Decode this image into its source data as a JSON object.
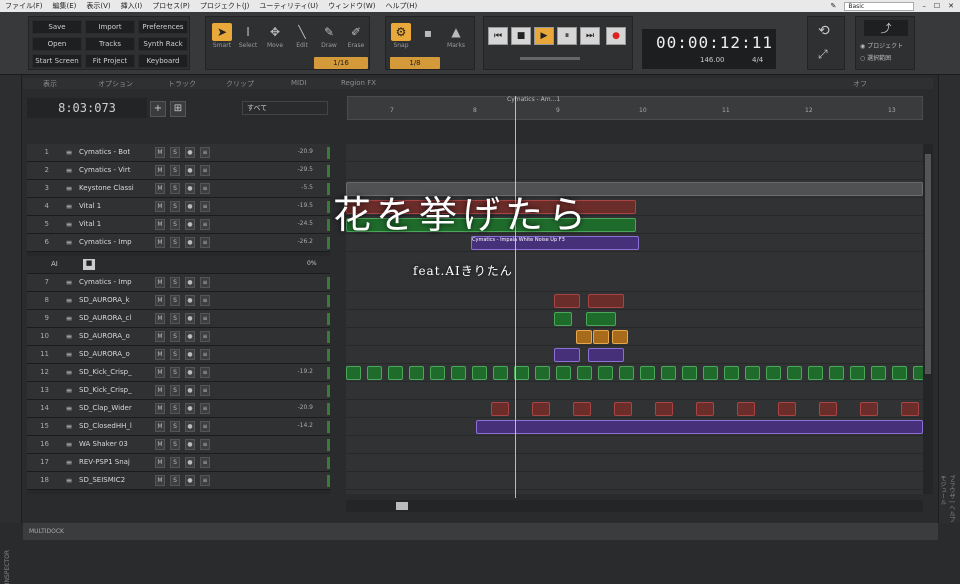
{
  "menu": {
    "items": [
      "ファイル(F)",
      "編集(E)",
      "表示(V)",
      "挿入(I)",
      "プロセス(P)",
      "プロジェクト(J)",
      "ユーティリティ(U)",
      "ウィンドウ(W)",
      "ヘルプ(H)"
    ],
    "workspace": "Basic"
  },
  "control": {
    "buttons": [
      "Save",
      "Import",
      "Preferences",
      "Open",
      "Tracks",
      "Synth Rack",
      "Start Screen",
      "Fit Project",
      "Keyboard"
    ],
    "tools": [
      "Smart",
      "Select",
      "Move",
      "Edit",
      "Draw",
      "Erase"
    ],
    "snap_label": "Snap",
    "snap_value": "1/16",
    "marks_label": "Marks",
    "marks_value": "1/8",
    "time": "00:00:12:11",
    "tempo": "146.00",
    "meter": "4/4",
    "option1": "プロジェクト",
    "option2": "選択範囲"
  },
  "tabs": [
    "表示",
    "オプション",
    "トラック",
    "クリップ",
    "MIDI",
    "Region FX",
    "オフ"
  ],
  "clock": "8:03:073",
  "filter": "すべて",
  "region_name": "Cymatics - Am...1",
  "ruler_ticks": [
    "7",
    "8",
    "9",
    "10",
    "11",
    "12",
    "13"
  ],
  "tracks": [
    {
      "num": "1",
      "name": "Cymatics - Bot",
      "vol": "-20.9"
    },
    {
      "num": "2",
      "name": "Cymatics - Virt",
      "vol": "-29.5"
    },
    {
      "num": "3",
      "name": "Keystone Classi",
      "vol": "-5.5"
    },
    {
      "num": "4",
      "name": "Vital 1",
      "vol": "-19.5"
    },
    {
      "num": "5",
      "name": "Vital 1",
      "vol": "-24.5"
    },
    {
      "num": "6",
      "name": "Cymatics - Imp",
      "vol": "-26.2"
    },
    {
      "num": "7",
      "name": "Cymatics - Imp",
      "vol": ""
    },
    {
      "num": "8",
      "name": "SD_AURORA_k",
      "vol": ""
    },
    {
      "num": "9",
      "name": "SD_AURORA_cl",
      "vol": ""
    },
    {
      "num": "10",
      "name": "SD_AURORA_o",
      "vol": ""
    },
    {
      "num": "11",
      "name": "SD_AURORA_o",
      "vol": ""
    },
    {
      "num": "12",
      "name": "SD_Kick_Crisp_",
      "vol": "-19.2"
    },
    {
      "num": "13",
      "name": "SD_Kick_Crisp_",
      "vol": ""
    },
    {
      "num": "14",
      "name": "SD_Clap_Wider",
      "vol": "-20.9"
    },
    {
      "num": "15",
      "name": "SD_ClosedHH_l",
      "vol": "-14.2"
    },
    {
      "num": "16",
      "name": "WA Shaker 03",
      "vol": ""
    },
    {
      "num": "17",
      "name": "REV-PSP1 Snaj",
      "vol": ""
    },
    {
      "num": "18",
      "name": "SD_SEISMIC2",
      "vol": ""
    }
  ],
  "ai_row": {
    "label": "AI",
    "value": "0%"
  },
  "clip_label": "Cymatics - Impala White Noise Up F3",
  "multidock": "MULTIDOCK",
  "inspector": "INSPECTOR",
  "browser": "ブラウザ | ヘルプモジュール",
  "overlay": {
    "title": "花を挙げたら",
    "subtitle": "feat.AIきりたん"
  }
}
